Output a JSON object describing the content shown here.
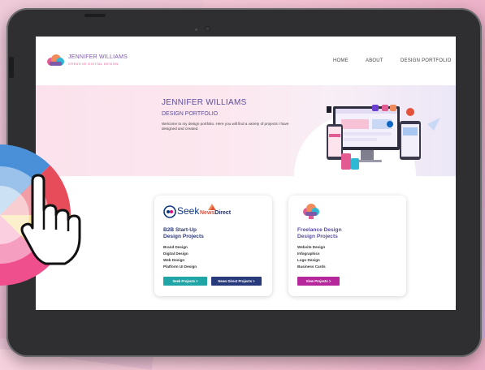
{
  "site": {
    "brand_name": "JENNIFER WILLIAMS",
    "brand_tagline": "CREATIVE DIGITAL DESIGN",
    "nav": [
      "HOME",
      "ABOUT",
      "DESIGN PORTFOLIO"
    ]
  },
  "hero": {
    "title": "JENNIFER WILLIAMS",
    "subtitle": "DESIGN PORTFOLIO",
    "description": "Welcome to my design portfolio. Here you will find a variety of projects I have designed and created."
  },
  "cards": [
    {
      "logo_seek": "Seek",
      "logo_news": "NewsDirect",
      "logo_news_a": "News",
      "logo_news_b": "Direct",
      "title_line1": "B2B Start-Up",
      "title_line2": "Design Projects",
      "items": [
        "Brand Design",
        "Digital Design",
        "Web Design",
        "Platform UI Design"
      ],
      "buttons": [
        "Seek Projects  >",
        "News Direct Projects  >"
      ]
    },
    {
      "title_line1": "Freelance Design",
      "title_line2": "Design Projects",
      "items": [
        "Website Design",
        "Infographics",
        "Logo Design",
        "Business Cards"
      ],
      "buttons": [
        "View Projects  >"
      ]
    }
  ],
  "colors": {
    "brand_purple": "#5c4da0",
    "brand_pink": "#e25c92",
    "seek_button": "#1fa5a6",
    "news_button": "#283a7c",
    "view_button": "#b5279a",
    "card1_title": "#2f3a77",
    "card2_title": "#5c4da0"
  },
  "icons": [
    "cloud-logo-icon",
    "seek-logo-icon",
    "newsdirect-logo-icon",
    "color-wheel-icon",
    "pointing-hand-icon",
    "devices-illustration",
    "paper-plane-icon"
  ]
}
